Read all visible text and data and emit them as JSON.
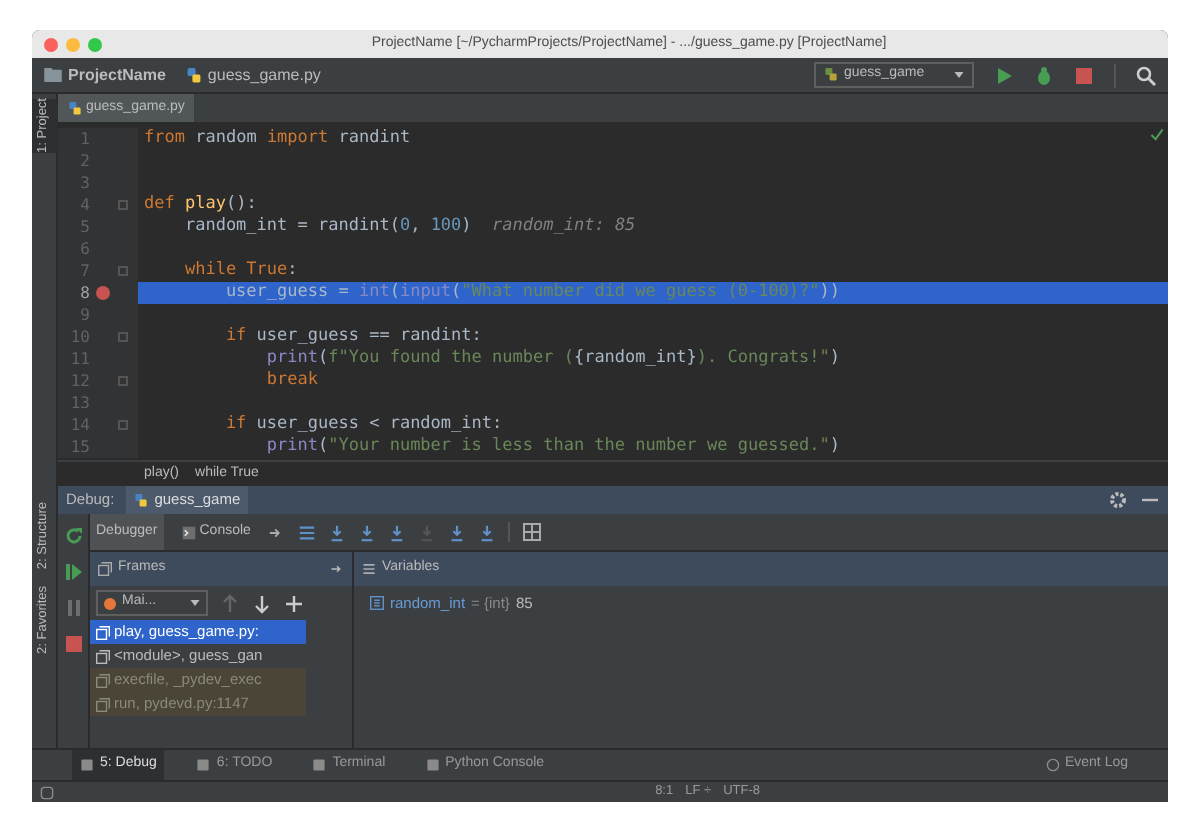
{
  "window": {
    "title": "ProjectName [~/PycharmProjects/ProjectName] - .../guess_game.py [ProjectName]"
  },
  "navbar": {
    "project": "ProjectName",
    "file": "guess_game.py",
    "run_config": "guess_game"
  },
  "left_stripe": [
    {
      "label": "1: Project",
      "selected": true
    },
    {
      "label": "2: Structure",
      "selected": false
    },
    {
      "label": "2: Favorites",
      "selected": false
    }
  ],
  "editor_tabs": [
    {
      "label": "guess_game.py",
      "selected": true
    }
  ],
  "code_lines": [
    {
      "number": "1",
      "fold": false,
      "breakpoint": false,
      "current": false,
      "tokens": [
        {
          "kind": "kw",
          "text": "from"
        },
        {
          "kind": "plain",
          "text": " random "
        },
        {
          "kind": "kw",
          "text": "import"
        },
        {
          "kind": "plain",
          "text": " randint"
        }
      ]
    },
    {
      "number": "2",
      "fold": false,
      "breakpoint": false,
      "current": false
    },
    {
      "number": "3",
      "fold": false,
      "breakpoint": false,
      "current": false
    },
    {
      "number": "4",
      "fold": true,
      "breakpoint": false,
      "current": false,
      "tokens": [
        {
          "kind": "kw",
          "text": "def"
        },
        {
          "kind": "fn",
          "text": " play"
        },
        {
          "kind": "plain",
          "text": "():"
        }
      ]
    },
    {
      "number": "5",
      "fold": false,
      "breakpoint": false,
      "current": false,
      "tokens": [
        {
          "kind": "plain",
          "text": "    random_int = randint("
        },
        {
          "kind": "num",
          "text": "0"
        },
        {
          "kind": "plain",
          "text": ", "
        },
        {
          "kind": "num",
          "text": "100"
        },
        {
          "kind": "plain",
          "text": ")  "
        },
        {
          "kind": "hint",
          "text": "random_int: 85"
        }
      ]
    },
    {
      "number": "6",
      "fold": false,
      "breakpoint": false,
      "current": false
    },
    {
      "number": "7",
      "fold": true,
      "breakpoint": false,
      "current": false,
      "tokens": [
        {
          "kind": "kw",
          "text": "    while True"
        },
        {
          "kind": "plain",
          "text": ":"
        }
      ]
    },
    {
      "number": "8",
      "fold": false,
      "breakpoint": true,
      "current": true,
      "tokens": [
        {
          "kind": "plain",
          "text": "        user_guess = "
        },
        {
          "kind": "builtin",
          "text": "int"
        },
        {
          "kind": "plain",
          "text": "("
        },
        {
          "kind": "builtin",
          "text": "input"
        },
        {
          "kind": "plain",
          "text": "("
        },
        {
          "kind": "str",
          "text": "\"What number did we guess (0-100)?\""
        },
        {
          "kind": "plain",
          "text": "))"
        }
      ]
    },
    {
      "number": "9",
      "fold": false,
      "breakpoint": false,
      "current": false
    },
    {
      "number": "10",
      "fold": true,
      "breakpoint": false,
      "current": false,
      "tokens": [
        {
          "kind": "kw",
          "text": "        if"
        },
        {
          "kind": "plain",
          "text": " user_guess == randint:"
        }
      ]
    },
    {
      "number": "11",
      "fold": false,
      "breakpoint": false,
      "current": false,
      "tokens": [
        {
          "kind": "builtin",
          "text": "            print"
        },
        {
          "kind": "plain",
          "text": "("
        },
        {
          "kind": "str",
          "text": "f\"You found the number ("
        },
        {
          "kind": "plain",
          "text": "{random_int}"
        },
        {
          "kind": "str",
          "text": "). Congrats!\""
        },
        {
          "kind": "plain",
          "text": ")"
        }
      ]
    },
    {
      "number": "12",
      "fold": true,
      "breakpoint": false,
      "current": false,
      "tokens": [
        {
          "kind": "kw",
          "text": "            break"
        }
      ]
    },
    {
      "number": "13",
      "fold": false,
      "breakpoint": false,
      "current": false
    },
    {
      "number": "14",
      "fold": true,
      "breakpoint": false,
      "current": false,
      "tokens": [
        {
          "kind": "kw",
          "text": "        if"
        },
        {
          "kind": "plain",
          "text": " user_guess < random_int:"
        }
      ]
    },
    {
      "number": "15",
      "fold": false,
      "breakpoint": false,
      "current": false,
      "tokens": [
        {
          "kind": "builtin",
          "text": "            print"
        },
        {
          "kind": "plain",
          "text": "("
        },
        {
          "kind": "str",
          "text": "\"Your number is less than the number we guessed.\""
        },
        {
          "kind": "plain",
          "text": ")"
        }
      ]
    }
  ],
  "breadcrumbs": [
    "play()",
    "while True"
  ],
  "debug": {
    "label": "Debug:",
    "session_tab": "guess_game",
    "tabs": [
      {
        "label": "Debugger",
        "selected": true
      },
      {
        "label": "Console",
        "selected": false
      }
    ],
    "frames": {
      "title": "Frames",
      "thread": "Mai...",
      "items": [
        {
          "label": "play, guess_game.py:",
          "selected": true,
          "library": false
        },
        {
          "label": "<module>, guess_gan",
          "selected": false,
          "library": false
        },
        {
          "label": "execfile, _pydev_exec",
          "selected": false,
          "library": true
        },
        {
          "label": "run, pydevd.py:1147",
          "selected": false,
          "library": true
        }
      ]
    },
    "variables": {
      "title": "Variables",
      "items": [
        {
          "name": "random_int",
          "type": "= {int}",
          "value": "85"
        }
      ]
    }
  },
  "tool_tabs": [
    {
      "label": "5: Debug",
      "selected": true
    },
    {
      "label": "6: TODO",
      "selected": false
    },
    {
      "label": "Terminal",
      "selected": false
    },
    {
      "label": "Python Console",
      "selected": false
    }
  ],
  "status_bar": {
    "event_log": "Event Log",
    "position": "8:1",
    "line_sep": "LF ÷",
    "encoding": "UTF-8"
  }
}
